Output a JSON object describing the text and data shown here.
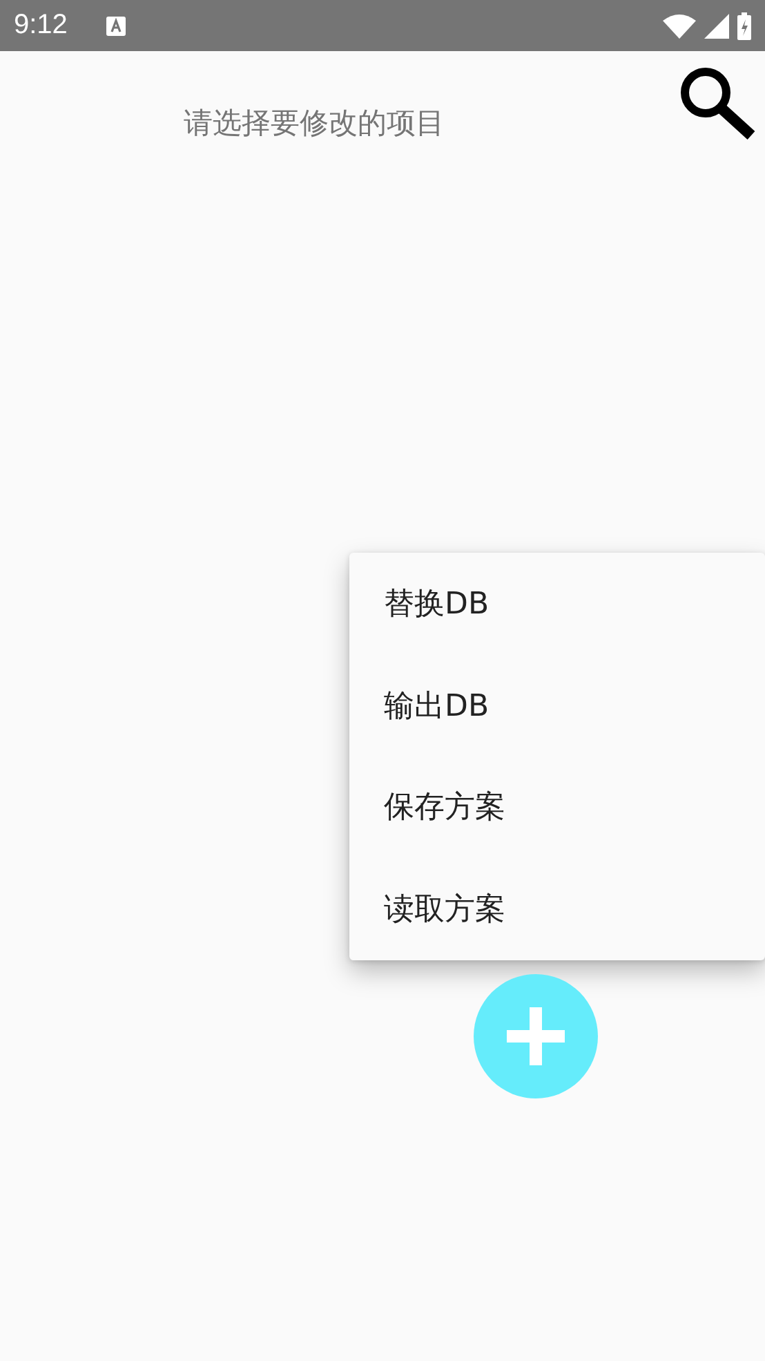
{
  "status_bar": {
    "time": "9:12"
  },
  "header": {
    "title": "请选择要修改的项目"
  },
  "menu": {
    "items": [
      {
        "label": "替换DB"
      },
      {
        "label": "输出DB"
      },
      {
        "label": "保存方案"
      },
      {
        "label": "读取方案"
      }
    ]
  }
}
